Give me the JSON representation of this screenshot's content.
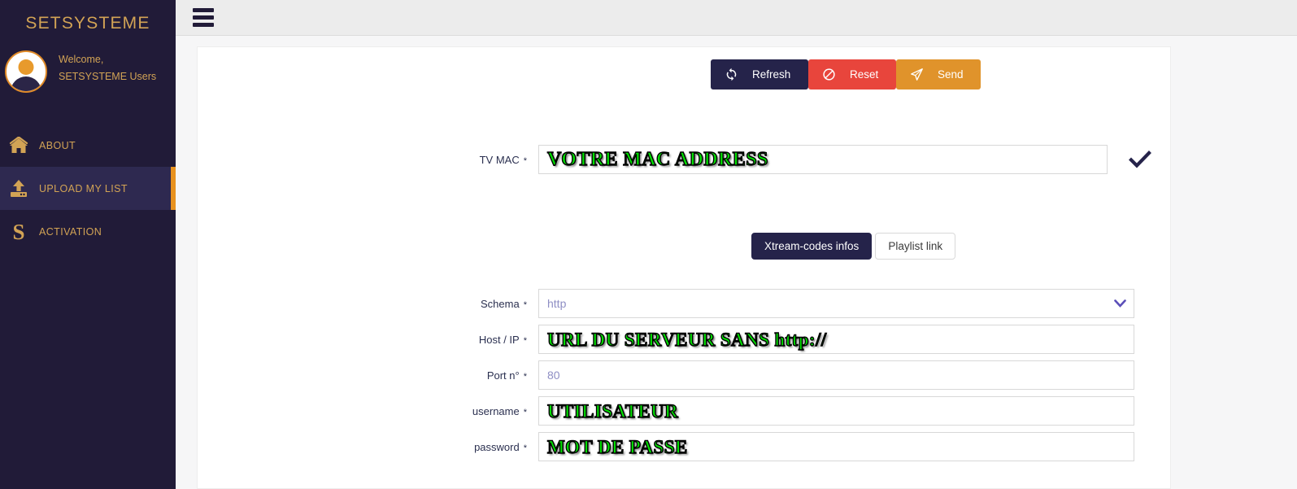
{
  "sidebar": {
    "brand": "SETSYSTEME",
    "welcome_greeting": "Welcome,",
    "welcome_user": "SETSYSTEME Users",
    "avatar_icon": "user-avatar-icon",
    "items": [
      {
        "label": "ABOUT",
        "icon": "home-icon",
        "active": false
      },
      {
        "label": "UPLOAD MY LIST",
        "icon": "upload-icon",
        "active": true
      },
      {
        "label": "ACTIVATION",
        "icon": "letter-s-icon",
        "active": false
      }
    ]
  },
  "topbar": {
    "menu_icon": "hamburger-menu-icon"
  },
  "actions": {
    "refresh_label": "Refresh",
    "refresh_icon": "refresh-icon",
    "reset_label": "Reset",
    "reset_icon": "ban-icon",
    "send_label": "Send",
    "send_icon": "paper-plane-icon"
  },
  "mac_field": {
    "label": "TV MAC",
    "required_mark": "*",
    "value": "VOTRE MAC ADDRESS",
    "valid_icon": "checkmark-icon"
  },
  "tabs": [
    {
      "label": "Xtream-codes infos",
      "active": true
    },
    {
      "label": "Playlist link",
      "active": false
    }
  ],
  "form_fields": [
    {
      "label": "Schema",
      "required_mark": "*",
      "type": "select",
      "value": "",
      "placeholder": "http",
      "icon": "chevron-down-icon"
    },
    {
      "label": "Host / IP",
      "required_mark": "*",
      "type": "text",
      "value": "URL DU SERVEUR  SANS  http://",
      "placeholder": ""
    },
    {
      "label": "Port n°",
      "required_mark": "*",
      "type": "text",
      "value": "",
      "placeholder": "80"
    },
    {
      "label": "username",
      "required_mark": "*",
      "type": "text",
      "value": "UTILISATEUR",
      "placeholder": ""
    },
    {
      "label": "password",
      "required_mark": "*",
      "type": "text",
      "value": "MOT DE  PASSE",
      "placeholder": ""
    }
  ],
  "colors": {
    "sidebar_bg": "#211b38",
    "sidebar_accent": "#d2a355",
    "active_bar": "#e8921f",
    "navy": "#25234a",
    "red": "#e8453c",
    "orange": "#e0932b",
    "green_text": "#00e000",
    "topbar_bg": "#ececec"
  }
}
